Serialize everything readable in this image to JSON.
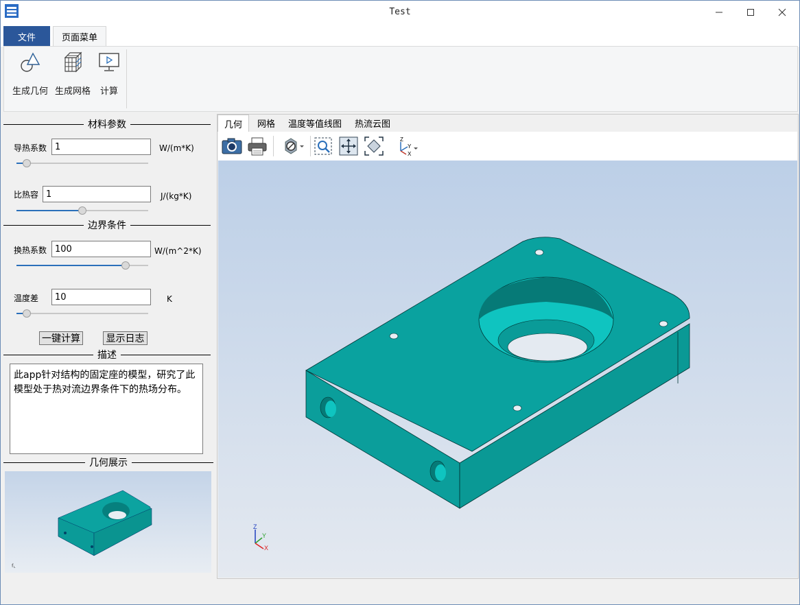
{
  "window": {
    "title": "Test"
  },
  "ribbon_tabs": {
    "file": "文件",
    "page_menu": "页面菜单"
  },
  "ribbon_buttons": {
    "geometry": "生成几何",
    "mesh": "生成网格",
    "compute": "计算"
  },
  "material": {
    "section_title": "材料参数",
    "conductivity": {
      "label": "导热系数",
      "value": "1",
      "unit": "W/(m*K)",
      "slider_fraction": 0.05
    },
    "heat_capacity": {
      "label": "比热容",
      "value": "1",
      "unit": "J/(kg*K)",
      "slider_fraction": 0.5
    }
  },
  "boundary": {
    "section_title": "边界条件",
    "htc": {
      "label": "换热系数",
      "value": "100",
      "unit": "W/(m^2*K)",
      "slider_fraction": 0.85
    },
    "temp_diff": {
      "label": "温度差",
      "value": "10",
      "unit": "K",
      "slider_fraction": 0.05
    }
  },
  "actions": {
    "compute": "一键计算",
    "show_log": "显示日志"
  },
  "description": {
    "section_title": "描述",
    "text": "此app针对结构的固定座的模型，研究了此模型处于热对流边界条件下的热场分布。"
  },
  "geometry_preview": {
    "section_title": "几何展示"
  },
  "view_tabs": [
    "几何",
    "网格",
    "温度等值线图",
    "热流云图"
  ],
  "view_tab_active": 0,
  "toolbar_icons": [
    "camera-icon",
    "printer-icon",
    "no-entry-icon",
    "zoom-box-icon",
    "pan-icon",
    "fit-view-icon",
    "axes-icon"
  ],
  "triad": {
    "x": "X",
    "y": "Y",
    "z": "Z"
  },
  "colors": {
    "title_blue": "#2b579a",
    "model_teal": "#0ca3a0",
    "viewport_top": "#bccfe7",
    "viewport_bottom": "#e4e9f0"
  }
}
